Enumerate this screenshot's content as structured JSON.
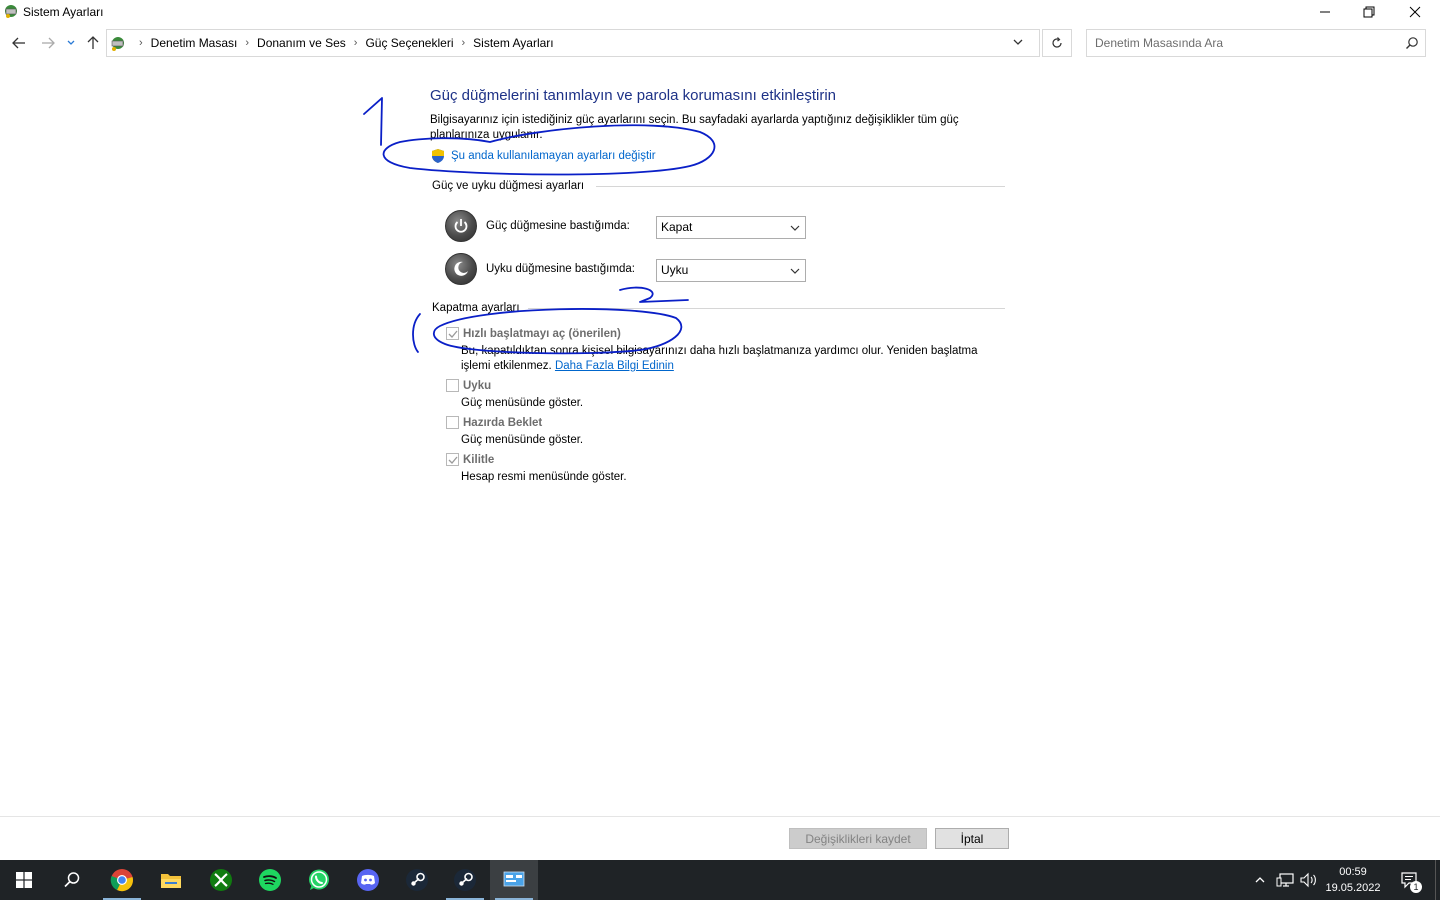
{
  "window": {
    "title": "Sistem Ayarları"
  },
  "address": {
    "crumbs": [
      "Denetim Masası",
      "Donanım ve Ses",
      "Güç Seçenekleri",
      "Sistem Ayarları"
    ],
    "search_placeholder": "Denetim Masasında Ara"
  },
  "page": {
    "title": "Güç düğmelerini tanımlayın ve parola korumasını etkinleştirin",
    "description": "Bilgisayarınız için istediğiniz güç ayarlarını seçin. Bu sayfadaki ayarlarda yaptığınız değişiklikler tüm güç planlarınıza uygulanır.",
    "admin_link": "Şu anda kullanılamayan ayarları değiştir"
  },
  "power_section": {
    "header": "Güç ve uyku düğmesi ayarları",
    "rows": [
      {
        "label": "Güç düğmesine bastığımda:",
        "value": "Kapat"
      },
      {
        "label": "Uyku düğmesine bastığımda:",
        "value": "Uyku"
      }
    ]
  },
  "shutdown_section": {
    "header": "Kapatma ayarları",
    "fast_startup": {
      "label": "Hızlı başlatmayı aç (önerilen)",
      "checked": true,
      "desc1": "Bu, kapatıldıktan sonra kişisel bilgisayarınızı daha hızlı başlatmanıza yardımcı olur. Yeniden başlatma",
      "desc2": "işlemi etkilenmez.",
      "link": "Daha Fazla Bilgi Edinin"
    },
    "sleep": {
      "label": "Uyku",
      "checked": false,
      "desc": "Güç menüsünde göster."
    },
    "hibernate": {
      "label": "Hazırda Beklet",
      "checked": false,
      "desc": "Güç menüsünde göster."
    },
    "lock": {
      "label": "Kilitle",
      "checked": true,
      "desc": "Hesap resmi menüsünde göster."
    }
  },
  "buttons": {
    "save": "Değişiklikleri kaydet",
    "cancel": "İptal"
  },
  "taskbar": {
    "time": "00:59",
    "date": "19.05.2022",
    "notification_count": "1"
  },
  "colors": {
    "title_blue": "#1e3287",
    "link_blue": "#0066cc",
    "annotation_ink": "#0a1fc7",
    "taskbar_bg": "#1f2326"
  }
}
